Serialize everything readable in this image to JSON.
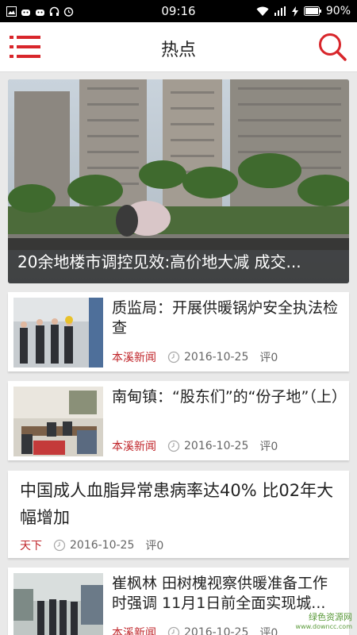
{
  "status_bar": {
    "time": "09:16",
    "battery": "90%"
  },
  "header": {
    "title": "热点"
  },
  "feature": {
    "caption": "20余地楼市调控见效:高价地大减 成交..."
  },
  "articles": [
    {
      "title": "质监局：开展供暖锅炉安全执法检查",
      "source": "本溪新闻",
      "date": "2016-10-25",
      "comments": "评0"
    },
    {
      "title": "南甸镇：“股东们”的“份子地”（上）",
      "source": "本溪新闻",
      "date": "2016-10-25",
      "comments": "评0"
    },
    {
      "title": "中国成人血脂异常患病率达40% 比02年大幅增加",
      "source": "天下",
      "date": "2016-10-25",
      "comments": "评0"
    },
    {
      "title": "崔枫林 田树槐视察供暖准备工作时强调 11月1日前全面实现城...",
      "source": "本溪新闻",
      "date": "2016-10-25",
      "comments": "评0"
    }
  ],
  "watermark": {
    "line1": "绿色资源网",
    "line2": "www.downcc.com"
  },
  "colors": {
    "accent": "#d8262b",
    "source": "#c0262b",
    "statusbar": "#000000"
  }
}
